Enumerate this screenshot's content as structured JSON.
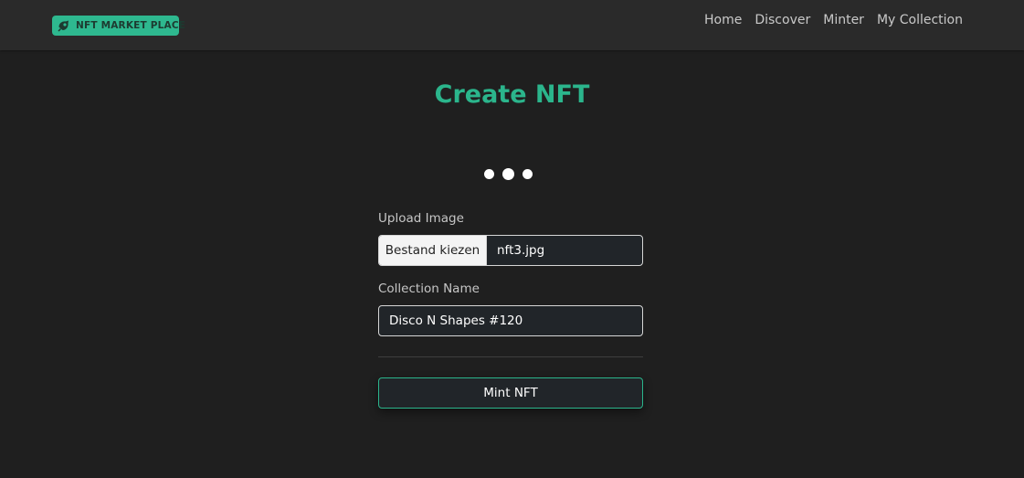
{
  "header": {
    "brand": {
      "label": "NFT MARKET PLACE",
      "icon": "rocket-icon"
    },
    "nav": [
      {
        "label": "Home"
      },
      {
        "label": "Discover"
      },
      {
        "label": "Minter"
      },
      {
        "label": "My Collection"
      }
    ]
  },
  "main": {
    "title": "Create NFT",
    "loader": {
      "icon": "loading-dots-icon"
    },
    "upload": {
      "label": "Upload Image",
      "button_label": "Bestand kiezen",
      "file_name": "nft3.jpg"
    },
    "collection": {
      "label": "Collection Name",
      "value": "Disco N Shapes #120"
    },
    "mint_button": "Mint NFT"
  },
  "colors": {
    "accent": "#2bb58c",
    "background": "#1f1f1f",
    "navbar": "#2a2a2a"
  }
}
